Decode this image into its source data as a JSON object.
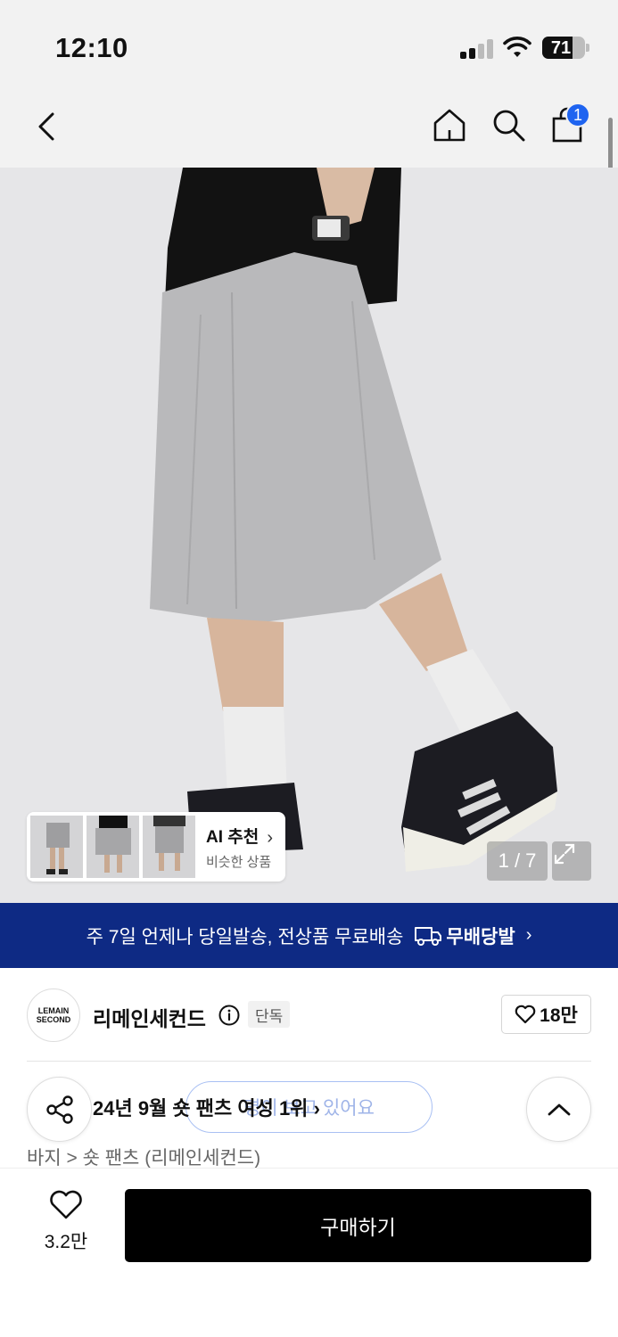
{
  "status_bar": {
    "time": "12:10",
    "battery": "71",
    "battery_level": 0.71
  },
  "nav": {
    "cart_count": "1"
  },
  "hero": {
    "ai_title": "AI 추천",
    "ai_subtitle": "비슷한 상품",
    "image_counter": "1 / 7"
  },
  "banner": {
    "text": "주 7일 언제나 당일발송, 전상품 무료배송",
    "logo_text": "무배당발"
  },
  "brand": {
    "logo_line1": "LEMAIN",
    "logo_line2": "SECOND",
    "name": "리메인세컨드",
    "exclusive_tag": "단독",
    "likes": "18만"
  },
  "ranking": {
    "text": "24년 9월 숏 팬츠 여성 1위",
    "viewing_overlay": "명이 보고 있어요"
  },
  "breadcrumb": "바지 > 숏 팬츠 (리메인세컨드)",
  "bottom": {
    "wish_count": "3.2만",
    "buy_label": "구매하기"
  }
}
